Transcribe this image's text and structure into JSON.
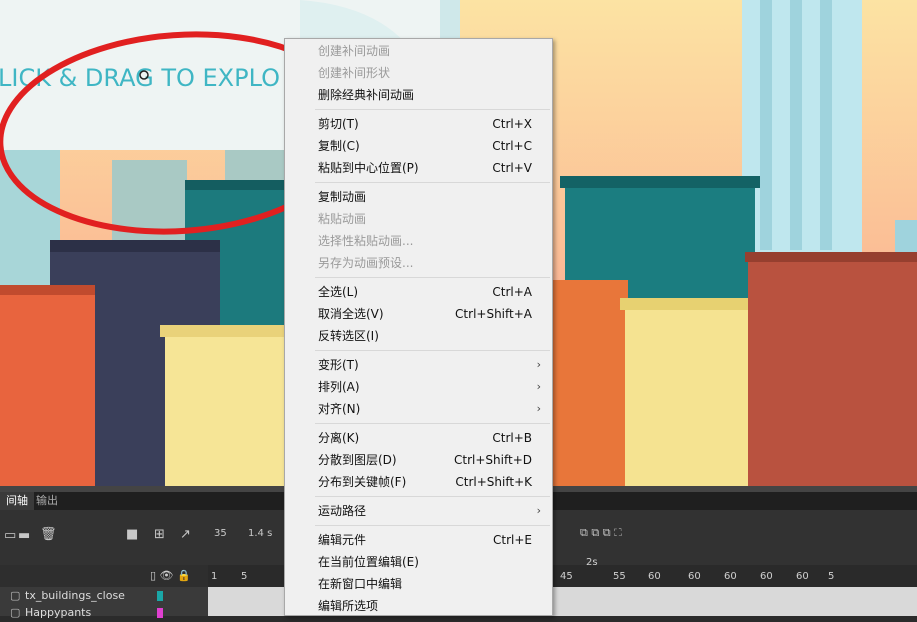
{
  "stage": {
    "banner_text": "LICK & DRAG TO EXPLO"
  },
  "menu": {
    "items": [
      {
        "label": "创建补间动画",
        "shortcut": "",
        "disabled": true
      },
      {
        "label": "创建补间形状",
        "shortcut": "",
        "disabled": true
      },
      {
        "label": "删除经典补间动画",
        "shortcut": "",
        "disabled": false
      },
      {
        "sep": true
      },
      {
        "label": "剪切(T)",
        "shortcut": "Ctrl+X",
        "disabled": false
      },
      {
        "label": "复制(C)",
        "shortcut": "Ctrl+C",
        "disabled": false
      },
      {
        "label": "粘贴到中心位置(P)",
        "shortcut": "Ctrl+V",
        "disabled": false
      },
      {
        "sep": true
      },
      {
        "label": "复制动画",
        "shortcut": "",
        "disabled": false
      },
      {
        "label": "粘贴动画",
        "shortcut": "",
        "disabled": true
      },
      {
        "label": "选择性粘贴动画...",
        "shortcut": "",
        "disabled": true
      },
      {
        "label": "另存为动画预设...",
        "shortcut": "",
        "disabled": true
      },
      {
        "sep": true
      },
      {
        "label": "全选(L)",
        "shortcut": "Ctrl+A",
        "disabled": false
      },
      {
        "label": "取消全选(V)",
        "shortcut": "Ctrl+Shift+A",
        "disabled": false
      },
      {
        "label": "反转选区(I)",
        "shortcut": "",
        "disabled": false
      },
      {
        "sep": true
      },
      {
        "label": "变形(T)",
        "shortcut": "",
        "disabled": false,
        "submenu": true
      },
      {
        "label": "排列(A)",
        "shortcut": "",
        "disabled": false,
        "submenu": true
      },
      {
        "label": "对齐(N)",
        "shortcut": "",
        "disabled": false,
        "submenu": true
      },
      {
        "sep": true
      },
      {
        "label": "分离(K)",
        "shortcut": "Ctrl+B",
        "disabled": false
      },
      {
        "label": "分散到图层(D)",
        "shortcut": "Ctrl+Shift+D",
        "disabled": false
      },
      {
        "label": "分布到关键帧(F)",
        "shortcut": "Ctrl+Shift+K",
        "disabled": false
      },
      {
        "sep": true
      },
      {
        "label": "运动路径",
        "shortcut": "",
        "disabled": false,
        "submenu": true
      },
      {
        "sep": true
      },
      {
        "label": "编辑元件",
        "shortcut": "Ctrl+E",
        "disabled": false
      },
      {
        "label": "在当前位置编辑(E)",
        "shortcut": "",
        "disabled": false
      },
      {
        "label": "在新窗口中编辑",
        "shortcut": "",
        "disabled": false
      },
      {
        "label": "编辑所选项",
        "shortcut": "",
        "disabled": false
      }
    ],
    "submenu_arrow": "›"
  },
  "timeline": {
    "tab_timeline": "间轴",
    "tab_output": "输出",
    "frame_num": "35",
    "time": "1.4 s",
    "marker_2s": "2s",
    "ruler_left": [
      "1",
      "5"
    ],
    "ruler_right": [
      "45",
      "55",
      "60",
      "60",
      "60",
      "60",
      "60",
      "5"
    ],
    "layers": [
      {
        "name": "tx_buildings_close",
        "color": "#1aa7a7"
      },
      {
        "name": "Happypants",
        "color": "#e040d0"
      }
    ]
  }
}
